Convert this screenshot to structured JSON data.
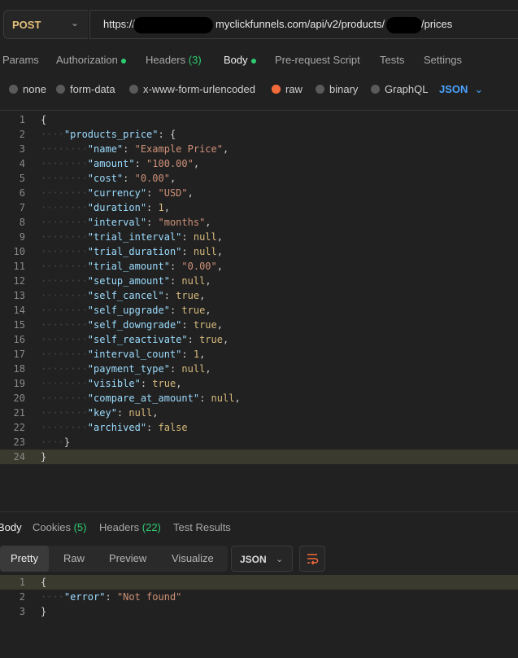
{
  "request": {
    "method": "POST",
    "url_prefix": "https://",
    "url_domain": "myclickfunnels.com/api/v2/products/",
    "url_suffix": "/prices"
  },
  "request_tabs": {
    "params": "Params",
    "authorization": "Authorization",
    "headers": "Headers",
    "headers_count": "(3)",
    "body": "Body",
    "prerequest": "Pre-request Script",
    "tests": "Tests",
    "settings": "Settings"
  },
  "body_types": {
    "none": "none",
    "form_data": "form-data",
    "urlencoded": "x-www-form-urlencoded",
    "raw": "raw",
    "binary": "binary",
    "graphql": "GraphQL",
    "format": "JSON"
  },
  "request_body": {
    "root_key": "products_price",
    "fields": [
      {
        "key": "name",
        "value": "\"Example Price\"",
        "type": "s"
      },
      {
        "key": "amount",
        "value": "\"100.00\"",
        "type": "s"
      },
      {
        "key": "cost",
        "value": "\"0.00\"",
        "type": "s"
      },
      {
        "key": "currency",
        "value": "\"USD\"",
        "type": "s"
      },
      {
        "key": "duration",
        "value": "1",
        "type": "n"
      },
      {
        "key": "interval",
        "value": "\"months\"",
        "type": "s"
      },
      {
        "key": "trial_interval",
        "value": "null",
        "type": "n"
      },
      {
        "key": "trial_duration",
        "value": "null",
        "type": "n"
      },
      {
        "key": "trial_amount",
        "value": "\"0.00\"",
        "type": "s"
      },
      {
        "key": "setup_amount",
        "value": "null",
        "type": "n"
      },
      {
        "key": "self_cancel",
        "value": "true",
        "type": "n"
      },
      {
        "key": "self_upgrade",
        "value": "true",
        "type": "n"
      },
      {
        "key": "self_downgrade",
        "value": "true",
        "type": "n"
      },
      {
        "key": "self_reactivate",
        "value": "true",
        "type": "n"
      },
      {
        "key": "interval_count",
        "value": "1",
        "type": "n"
      },
      {
        "key": "payment_type",
        "value": "null",
        "type": "n"
      },
      {
        "key": "visible",
        "value": "true",
        "type": "n"
      },
      {
        "key": "compare_at_amount",
        "value": "null",
        "type": "n"
      },
      {
        "key": "key",
        "value": "null",
        "type": "n"
      },
      {
        "key": "archived",
        "value": "false",
        "type": "n"
      }
    ]
  },
  "response_tabs": {
    "body": "Body",
    "cookies": "Cookies",
    "cookies_count": "(5)",
    "headers": "Headers",
    "headers_count": "(22)",
    "test_results": "Test Results"
  },
  "response_toolbar": {
    "pretty": "Pretty",
    "raw": "Raw",
    "preview": "Preview",
    "visualize": "Visualize",
    "format": "JSON"
  },
  "response_body": {
    "key": "error",
    "value": "\"Not found\""
  },
  "colors": {
    "method": "#e5c07b",
    "accent_orange": "#f26b3a",
    "status_green": "#2ecc71",
    "json_blue": "#4aa3ff"
  }
}
